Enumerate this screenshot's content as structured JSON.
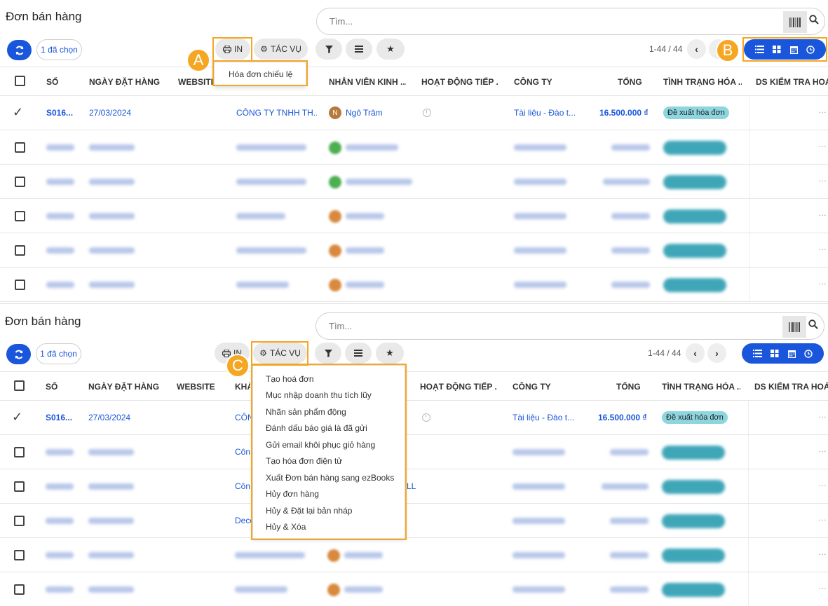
{
  "page_title": "Đơn bán hàng",
  "search": {
    "placeholder": "Tìm..."
  },
  "toolbar": {
    "selected_label": "1 đã chọn",
    "print_label": "IN",
    "action_label": "TÁC VỤ",
    "pager_text": "1-44 / 44"
  },
  "columns": [
    "SỐ",
    "NGÀY ĐẶT HÀNG",
    "WEBSITE",
    "KHÁCH HÀNG",
    "NHÂN VIÊN KINH ...",
    "HOẠT ĐỘNG TIẾP ...",
    "CÔNG TY",
    "TỔNG",
    "TÌNH TRẠNG HÓA ...",
    "DS KIỂM TRA HOÁ..."
  ],
  "first_row": {
    "number": "S016...",
    "date": "27/03/2024",
    "customer": "CÔNG TY TNHH TH...",
    "customer_short": "CÔN",
    "salesperson": "Ngô Trâm",
    "salesperson_initial": "N",
    "company": "Tài liệu - Đào t...",
    "total": "16.500.000 ₫",
    "invoice_status": "Đề xuất hóa đơn"
  },
  "panel2_customer_partials": [
    "Côn",
    "Côn",
    "Deco"
  ],
  "panel2_partial_tail": "LL",
  "print_menu": {
    "items": [
      "Hóa đơn chiếu lệ"
    ]
  },
  "action_menu": {
    "items": [
      "Tạo hoá đơn",
      "Mục nhập doanh thu tích lũy",
      "Nhãn sản phẩm động",
      "Đánh dấu báo giá là đã gửi",
      "Gửi email khôi phục giỏ hàng",
      "Tạo hóa đơn điện tử",
      "Xuất Đơn bán hàng sang ezBooks",
      "Hủy đơn hàng",
      "Hủy & Đặt lại bản nháp",
      "Hủy & Xóa"
    ]
  },
  "callouts": {
    "a": "A",
    "b": "B",
    "c": "C"
  },
  "colors": {
    "accent": "#1a56db",
    "highlight": "#f5a623",
    "status_pill": "#8dd6df"
  }
}
